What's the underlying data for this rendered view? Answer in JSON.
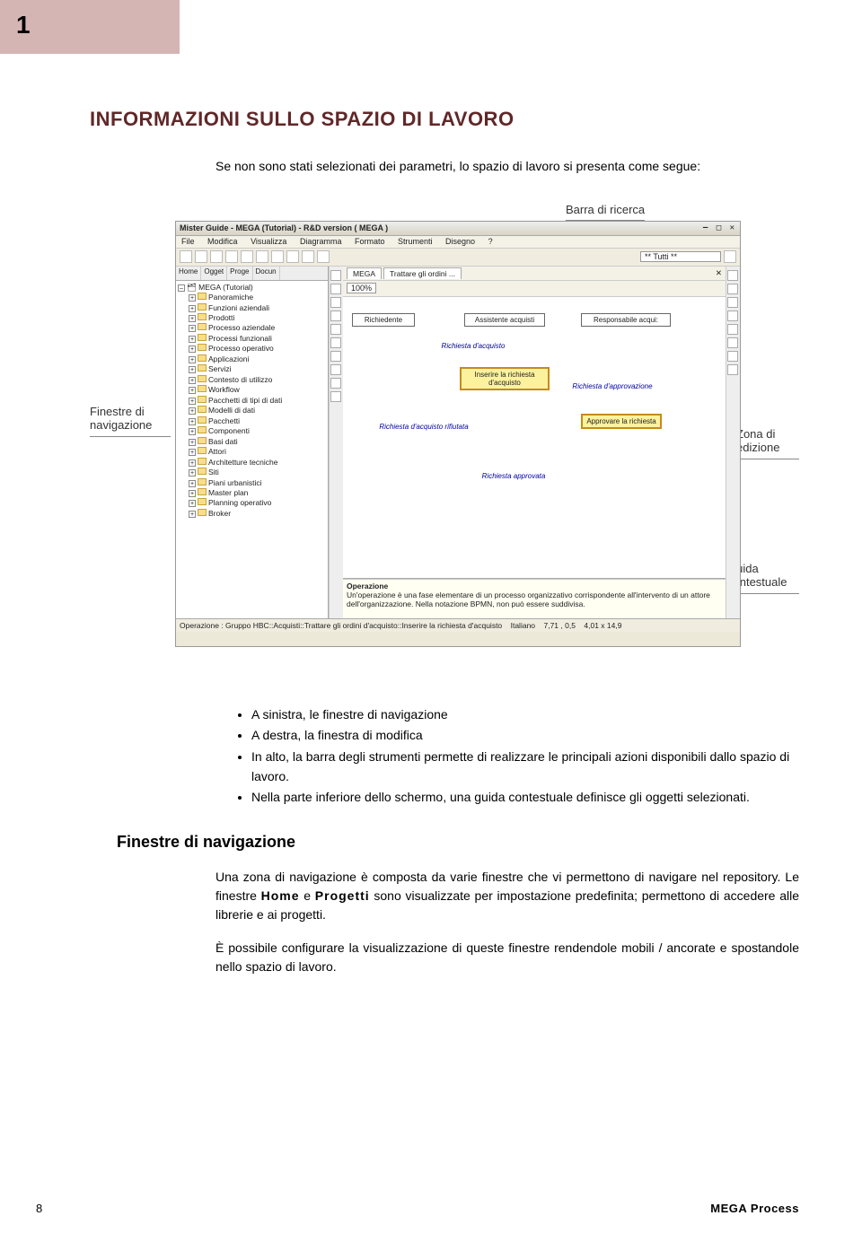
{
  "page": {
    "top_number": "1",
    "title": "INFORMAZIONI SULLO SPAZIO DI LAVORO",
    "intro": "Se non sono stati selezionati dei parametri, lo spazio di lavoro si presenta come segue:",
    "labels": {
      "search": "Barra di ricerca",
      "nav": "Finestre di navigazione",
      "edit": "Zona di edizione",
      "help": "Guida contestuale"
    },
    "bullets": [
      "A sinistra, le finestre di navigazione",
      "A destra, la finestra di modifica",
      "In alto, la barra degli strumenti permette di realizzare le principali azioni disponibili dallo spazio di lavoro.",
      "Nella parte inferiore dello schermo, una guida contestuale definisce gli oggetti selezionati."
    ],
    "subhead": "Finestre di navigazione",
    "para1_a": "Una zona di navigazione è composta da varie finestre che vi permettono di navigare nel repository. Le finestre ",
    "para1_kw1": "Home",
    "para1_b": " e ",
    "para1_kw2": "Progetti",
    "para1_c": " sono visualizzate per impostazione predefinita; permettono di accedere alle librerie e ai progetti.",
    "para2": "È possibile configurare la visualizzazione di queste finestre rendendole mobili / ancorate e spostandole nello spazio di lavoro.",
    "footer_page": "8",
    "footer_brand": "MEGA Process"
  },
  "app": {
    "title": "Mister Guide - MEGA (Tutorial) - R&D version ( MEGA )",
    "win_buttons": "— □ ✕",
    "menubar": [
      "File",
      "Modifica",
      "Visualizza",
      "Diagramma",
      "Formato",
      "Strumenti",
      "Disegno",
      "?"
    ],
    "toolbar_search": "** Tutti **",
    "side_tabs": [
      "Home",
      "Ogget",
      "Proge",
      "Docun"
    ],
    "tree_root": "MEGA (Tutorial)",
    "tree_items": [
      "Panoramiche",
      "Funzioni aziendali",
      "Prodotti",
      "Processo aziendale",
      "Processi funzionali",
      "Processo operativo",
      "Applicazioni",
      "Servizi",
      "Contesto di utilizzo",
      "Workflow",
      "Pacchetti di tipi di dati",
      "Modelli di dati",
      "Pacchetti",
      "Componenti",
      "Basi dati",
      "Attori",
      "Architetture tecniche",
      "Siti",
      "Piani urbanistici",
      "Master plan",
      "Planning operativo",
      "Broker"
    ],
    "canvas_tab1": "MEGA",
    "canvas_tab2": "Trattare gli ordini ...",
    "zoom": "100%",
    "actors": [
      "Richiedente",
      "Assistente acquisti",
      "Responsabile acqui:"
    ],
    "flows": {
      "f1": "Richiesta d'acquisto",
      "f2": "Inserire la richiesta d'acquisto",
      "f3": "Richiesta d'approvazione",
      "f4": "Approvare la richiesta",
      "f5": "Richiesta d'acquisto rifiutata",
      "f6": "Richiesta approvata"
    },
    "help_term": "Operazione",
    "help_text": "Un'operazione è una fase elementare di un processo organizzativo corrispondente all'intervento di un attore dell'organizzazione. Nella notazione BPMN, non può essere suddivisa.",
    "status_left": "Operazione : Gruppo HBC::Acquisti::Trattare gli ordini d'acquisto::Inserire la richiesta d'acquisto",
    "status_lang": "Italiano",
    "status_coords": "7,71 , 0,5",
    "status_size": "4,01 x 14,9"
  }
}
